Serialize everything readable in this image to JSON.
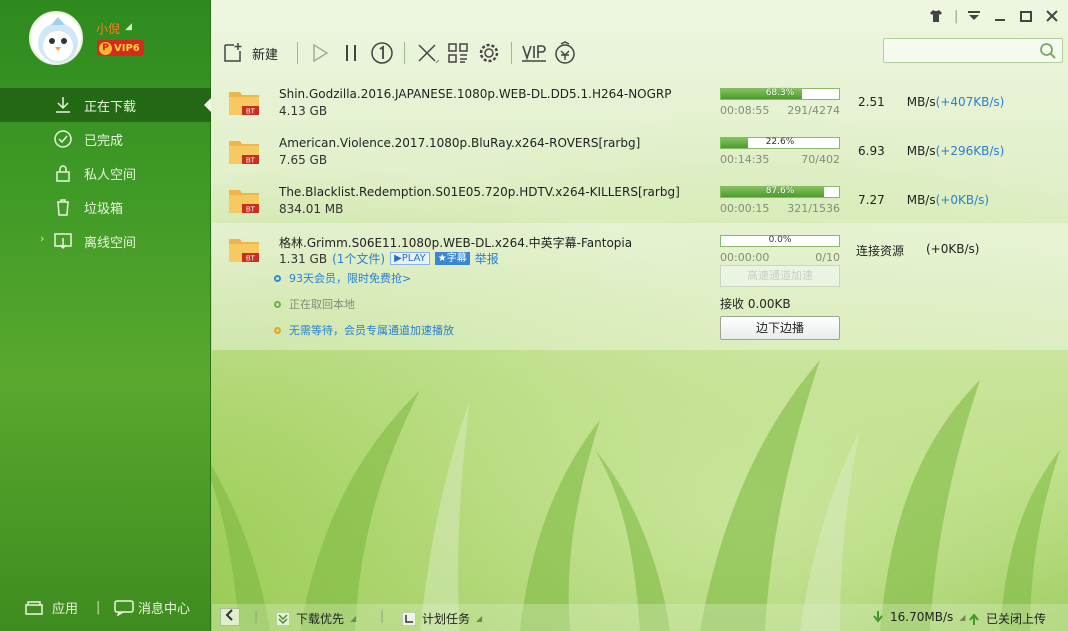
{
  "user": {
    "name": "小倪",
    "vip_level": "VIP6",
    "vip_letter": "P"
  },
  "nav": [
    {
      "label": "正在下载",
      "icon": "download-icon",
      "active": true
    },
    {
      "label": "已完成",
      "icon": "check-circle-icon",
      "active": false
    },
    {
      "label": "私人空间",
      "icon": "lock-icon",
      "active": false
    },
    {
      "label": "垃圾箱",
      "icon": "trash-icon",
      "active": false
    },
    {
      "label": "离线空间",
      "icon": "cloud-download-icon",
      "active": false
    }
  ],
  "sidebar_bottom": {
    "apps_label": "应用",
    "messages_label": "消息中心"
  },
  "toolbar": {
    "new_label": "新建"
  },
  "search": {
    "placeholder": ""
  },
  "tasks": [
    {
      "name": "Shin.Godzilla.2016.JAPANESE.1080p.WEB-DL.DD5.1.H264-NOGRP",
      "size": "4.13 GB",
      "progress": 68.3,
      "progress_label": "68.3%",
      "elapsed": "00:08:55",
      "pieces": "291/4274",
      "speed": "2.51",
      "unit": "MB/s",
      "boost": "(+407KB/s)"
    },
    {
      "name": "American.Violence.2017.1080p.BluRay.x264-ROVERS[rarbg]",
      "size": "7.65 GB",
      "progress": 22.6,
      "progress_label": "22.6%",
      "elapsed": "00:14:35",
      "pieces": "70/402",
      "speed": "6.93",
      "unit": "MB/s",
      "boost": "(+296KB/s)"
    },
    {
      "name": "The.Blacklist.Redemption.S01E05.720p.HDTV.x264-KILLERS[rarbg]",
      "size": "834.01 MB",
      "progress": 87.6,
      "progress_label": "87.6%",
      "elapsed": "00:00:15",
      "pieces": "321/1536",
      "speed": "7.27",
      "unit": "MB/s",
      "boost": "(+0KB/s)"
    }
  ],
  "expanded_task": {
    "name": "格林.Grimm.S06E11.1080p.WEB-DL.x264.中英字幕-Fantopia",
    "size": "1.31 GB",
    "files": "(1个文件)",
    "play_tag": "▶PLAY",
    "sub_tag": "★字幕",
    "report": "举报",
    "progress": 0,
    "progress_label": "0.0%",
    "elapsed": "00:00:00",
    "pieces": "0/10",
    "status": "连接资源",
    "boost": "(+0KB/s)",
    "promo1": "93天会员，限时免费抢>",
    "line2": "正在取回本地",
    "promo3": "无需等待，会员专属通道加速播放",
    "disabled_button": "高速通道加速",
    "receive": "接收 0.00KB",
    "play_button": "边下边播"
  },
  "statusbar": {
    "priority_label": "下载优先",
    "schedule_label": "计划任务",
    "total_speed": "16.70MB/s",
    "upload_status": "已关闭上传"
  }
}
